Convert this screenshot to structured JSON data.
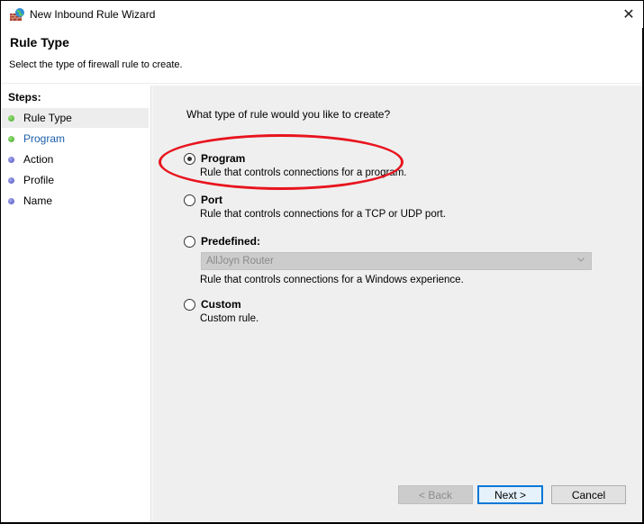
{
  "window": {
    "title": "New Inbound Rule Wizard",
    "app_icon": "firewall-icon",
    "close_icon": "close-icon",
    "close_glyph": "✕"
  },
  "header": {
    "title": "Rule Type",
    "subtitle": "Select the type of firewall rule to create."
  },
  "sidebar": {
    "steps_label": "Steps:",
    "steps": [
      {
        "label": "Rule Type",
        "status": "complete",
        "active": true
      },
      {
        "label": "Program",
        "status": "complete",
        "link": true
      },
      {
        "label": "Action",
        "status": "pending"
      },
      {
        "label": "Profile",
        "status": "pending"
      },
      {
        "label": "Name",
        "status": "pending"
      }
    ]
  },
  "main": {
    "question": "What type of rule would you like to create?",
    "options": [
      {
        "label": "Program",
        "description": "Rule that controls connections for a program.",
        "selected": true
      },
      {
        "label": "Port",
        "description": "Rule that controls connections for a TCP or UDP port.",
        "selected": false
      },
      {
        "label": "Predefined:",
        "description": "Rule that controls connections for a Windows experience.",
        "selected": false
      },
      {
        "label": "Custom",
        "description": "Custom rule.",
        "selected": false
      }
    ],
    "predefined_dropdown": {
      "value": "AllJoyn Router",
      "enabled": false,
      "chevron_glyph": "⌄"
    }
  },
  "buttons": {
    "back": "< Back",
    "next": "Next >",
    "cancel": "Cancel"
  },
  "colors": {
    "annotation": "#e8141e",
    "focus": "#0078d7",
    "step_complete": "#3fa62a",
    "step_pending": "#4a4fb8",
    "link": "#1d5fa8"
  }
}
